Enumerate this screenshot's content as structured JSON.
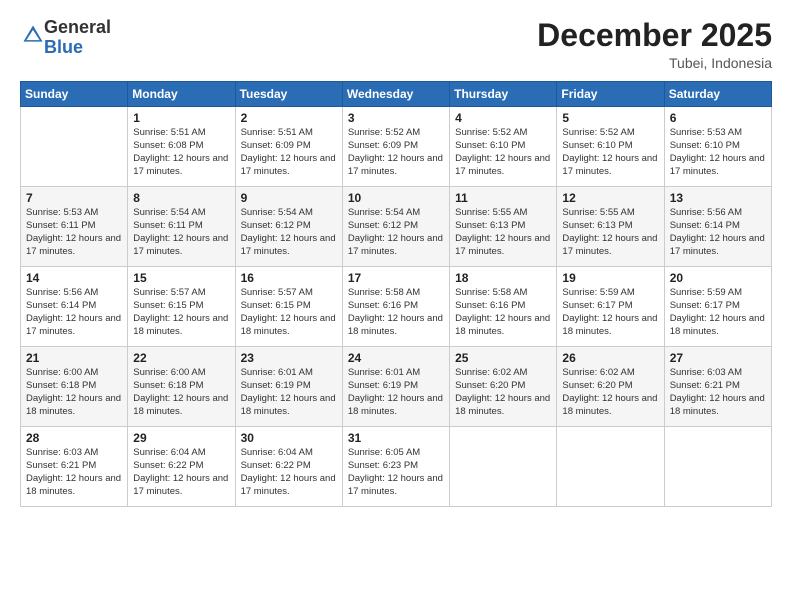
{
  "header": {
    "logo_general": "General",
    "logo_blue": "Blue",
    "month_title": "December 2025",
    "location": "Tubei, Indonesia"
  },
  "days_of_week": [
    "Sunday",
    "Monday",
    "Tuesday",
    "Wednesday",
    "Thursday",
    "Friday",
    "Saturday"
  ],
  "weeks": [
    [
      {
        "day": "",
        "sunrise": "",
        "sunset": "",
        "daylight": ""
      },
      {
        "day": "1",
        "sunrise": "Sunrise: 5:51 AM",
        "sunset": "Sunset: 6:08 PM",
        "daylight": "Daylight: 12 hours and 17 minutes."
      },
      {
        "day": "2",
        "sunrise": "Sunrise: 5:51 AM",
        "sunset": "Sunset: 6:09 PM",
        "daylight": "Daylight: 12 hours and 17 minutes."
      },
      {
        "day": "3",
        "sunrise": "Sunrise: 5:52 AM",
        "sunset": "Sunset: 6:09 PM",
        "daylight": "Daylight: 12 hours and 17 minutes."
      },
      {
        "day": "4",
        "sunrise": "Sunrise: 5:52 AM",
        "sunset": "Sunset: 6:10 PM",
        "daylight": "Daylight: 12 hours and 17 minutes."
      },
      {
        "day": "5",
        "sunrise": "Sunrise: 5:52 AM",
        "sunset": "Sunset: 6:10 PM",
        "daylight": "Daylight: 12 hours and 17 minutes."
      },
      {
        "day": "6",
        "sunrise": "Sunrise: 5:53 AM",
        "sunset": "Sunset: 6:10 PM",
        "daylight": "Daylight: 12 hours and 17 minutes."
      }
    ],
    [
      {
        "day": "7",
        "sunrise": "Sunrise: 5:53 AM",
        "sunset": "Sunset: 6:11 PM",
        "daylight": "Daylight: 12 hours and 17 minutes."
      },
      {
        "day": "8",
        "sunrise": "Sunrise: 5:54 AM",
        "sunset": "Sunset: 6:11 PM",
        "daylight": "Daylight: 12 hours and 17 minutes."
      },
      {
        "day": "9",
        "sunrise": "Sunrise: 5:54 AM",
        "sunset": "Sunset: 6:12 PM",
        "daylight": "Daylight: 12 hours and 17 minutes."
      },
      {
        "day": "10",
        "sunrise": "Sunrise: 5:54 AM",
        "sunset": "Sunset: 6:12 PM",
        "daylight": "Daylight: 12 hours and 17 minutes."
      },
      {
        "day": "11",
        "sunrise": "Sunrise: 5:55 AM",
        "sunset": "Sunset: 6:13 PM",
        "daylight": "Daylight: 12 hours and 17 minutes."
      },
      {
        "day": "12",
        "sunrise": "Sunrise: 5:55 AM",
        "sunset": "Sunset: 6:13 PM",
        "daylight": "Daylight: 12 hours and 17 minutes."
      },
      {
        "day": "13",
        "sunrise": "Sunrise: 5:56 AM",
        "sunset": "Sunset: 6:14 PM",
        "daylight": "Daylight: 12 hours and 17 minutes."
      }
    ],
    [
      {
        "day": "14",
        "sunrise": "Sunrise: 5:56 AM",
        "sunset": "Sunset: 6:14 PM",
        "daylight": "Daylight: 12 hours and 17 minutes."
      },
      {
        "day": "15",
        "sunrise": "Sunrise: 5:57 AM",
        "sunset": "Sunset: 6:15 PM",
        "daylight": "Daylight: 12 hours and 18 minutes."
      },
      {
        "day": "16",
        "sunrise": "Sunrise: 5:57 AM",
        "sunset": "Sunset: 6:15 PM",
        "daylight": "Daylight: 12 hours and 18 minutes."
      },
      {
        "day": "17",
        "sunrise": "Sunrise: 5:58 AM",
        "sunset": "Sunset: 6:16 PM",
        "daylight": "Daylight: 12 hours and 18 minutes."
      },
      {
        "day": "18",
        "sunrise": "Sunrise: 5:58 AM",
        "sunset": "Sunset: 6:16 PM",
        "daylight": "Daylight: 12 hours and 18 minutes."
      },
      {
        "day": "19",
        "sunrise": "Sunrise: 5:59 AM",
        "sunset": "Sunset: 6:17 PM",
        "daylight": "Daylight: 12 hours and 18 minutes."
      },
      {
        "day": "20",
        "sunrise": "Sunrise: 5:59 AM",
        "sunset": "Sunset: 6:17 PM",
        "daylight": "Daylight: 12 hours and 18 minutes."
      }
    ],
    [
      {
        "day": "21",
        "sunrise": "Sunrise: 6:00 AM",
        "sunset": "Sunset: 6:18 PM",
        "daylight": "Daylight: 12 hours and 18 minutes."
      },
      {
        "day": "22",
        "sunrise": "Sunrise: 6:00 AM",
        "sunset": "Sunset: 6:18 PM",
        "daylight": "Daylight: 12 hours and 18 minutes."
      },
      {
        "day": "23",
        "sunrise": "Sunrise: 6:01 AM",
        "sunset": "Sunset: 6:19 PM",
        "daylight": "Daylight: 12 hours and 18 minutes."
      },
      {
        "day": "24",
        "sunrise": "Sunrise: 6:01 AM",
        "sunset": "Sunset: 6:19 PM",
        "daylight": "Daylight: 12 hours and 18 minutes."
      },
      {
        "day": "25",
        "sunrise": "Sunrise: 6:02 AM",
        "sunset": "Sunset: 6:20 PM",
        "daylight": "Daylight: 12 hours and 18 minutes."
      },
      {
        "day": "26",
        "sunrise": "Sunrise: 6:02 AM",
        "sunset": "Sunset: 6:20 PM",
        "daylight": "Daylight: 12 hours and 18 minutes."
      },
      {
        "day": "27",
        "sunrise": "Sunrise: 6:03 AM",
        "sunset": "Sunset: 6:21 PM",
        "daylight": "Daylight: 12 hours and 18 minutes."
      }
    ],
    [
      {
        "day": "28",
        "sunrise": "Sunrise: 6:03 AM",
        "sunset": "Sunset: 6:21 PM",
        "daylight": "Daylight: 12 hours and 18 minutes."
      },
      {
        "day": "29",
        "sunrise": "Sunrise: 6:04 AM",
        "sunset": "Sunset: 6:22 PM",
        "daylight": "Daylight: 12 hours and 17 minutes."
      },
      {
        "day": "30",
        "sunrise": "Sunrise: 6:04 AM",
        "sunset": "Sunset: 6:22 PM",
        "daylight": "Daylight: 12 hours and 17 minutes."
      },
      {
        "day": "31",
        "sunrise": "Sunrise: 6:05 AM",
        "sunset": "Sunset: 6:23 PM",
        "daylight": "Daylight: 12 hours and 17 minutes."
      },
      {
        "day": "",
        "sunrise": "",
        "sunset": "",
        "daylight": ""
      },
      {
        "day": "",
        "sunrise": "",
        "sunset": "",
        "daylight": ""
      },
      {
        "day": "",
        "sunrise": "",
        "sunset": "",
        "daylight": ""
      }
    ]
  ]
}
